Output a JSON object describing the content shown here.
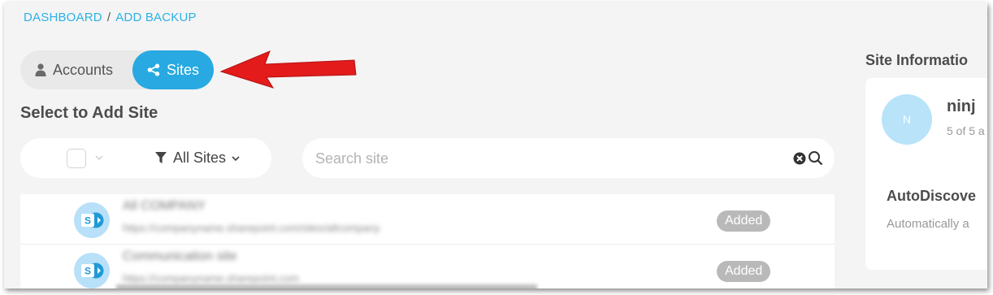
{
  "breadcrumb": {
    "home": "DASHBOARD",
    "separator": "/",
    "current": "ADD BACKUP"
  },
  "tabs": {
    "accounts": "Accounts",
    "sites": "Sites"
  },
  "section_title": "Select to Add Site",
  "filter": {
    "label": "All Sites"
  },
  "search": {
    "placeholder": "Search site",
    "value": ""
  },
  "sites": [
    {
      "name": "All COMPANY",
      "url": "https://companyname.sharepoint.com/sites/allcompany",
      "status": "Added"
    },
    {
      "name": "Communication site",
      "url": "https://companyname.sharepoint.com",
      "status": "Added"
    }
  ],
  "side_panel": {
    "title": "Site Informatio",
    "avatar_letter": "N",
    "name": "ninj",
    "count": "5 of 5 a",
    "autodiscover_title": "AutoDiscove",
    "autodiscover_desc": "Automatically a"
  },
  "colors": {
    "accent": "#28a9e1",
    "link": "#2bb1e6",
    "arrow": "#e31b1b",
    "badge": "#b9b9b9"
  },
  "icons": {
    "accounts": "user-icon",
    "sites": "share-icon",
    "filter": "filter-icon",
    "site": "sharepoint-icon"
  }
}
